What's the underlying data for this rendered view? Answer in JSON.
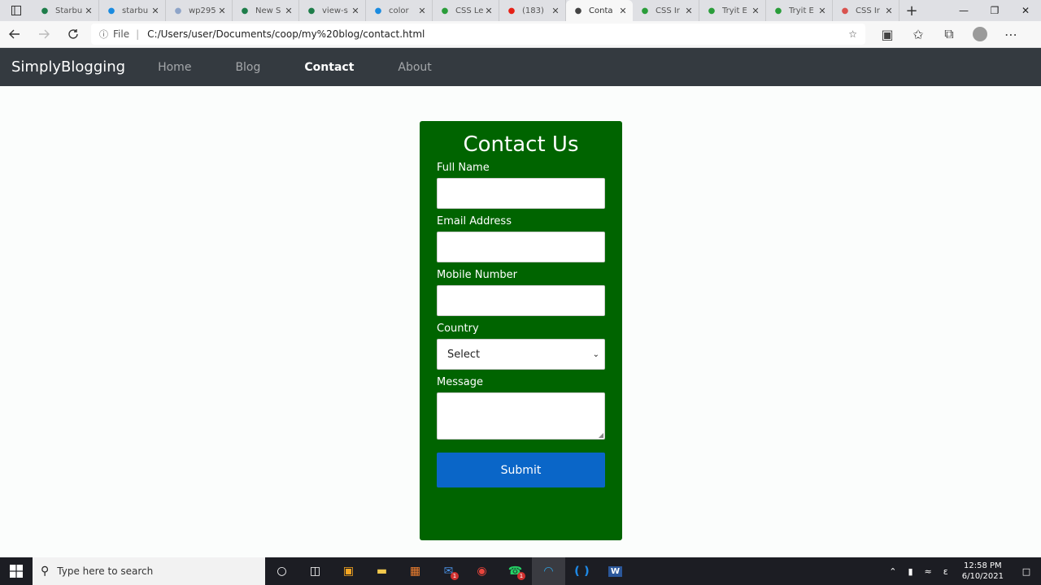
{
  "browser": {
    "tabs": [
      {
        "title": "Starbu",
        "favicon": "starbucks-icon",
        "color": "#1e7d4a"
      },
      {
        "title": "starbu",
        "favicon": "bing-icon",
        "color": "#1a8be0"
      },
      {
        "title": "wp295",
        "favicon": "wordpress-icon",
        "color": "#8ea4c8"
      },
      {
        "title": "New S",
        "favicon": "starbucks-icon",
        "color": "#1e7d4a"
      },
      {
        "title": "view-s",
        "favicon": "starbucks-icon",
        "color": "#1e7d4a"
      },
      {
        "title": "color",
        "favicon": "bing-icon",
        "color": "#1a8be0"
      },
      {
        "title": "CSS Le",
        "favicon": "w3schools-icon",
        "color": "#2a9d3a"
      },
      {
        "title": "(183)",
        "favicon": "youtube-icon",
        "color": "#e62117"
      },
      {
        "title": "Conta",
        "favicon": "page-icon",
        "color": "#444444",
        "active": true
      },
      {
        "title": "CSS Ir",
        "favicon": "w3schools-icon",
        "color": "#2a9d3a"
      },
      {
        "title": "Tryit E",
        "favicon": "w3schools-icon",
        "color": "#2a9d3a"
      },
      {
        "title": "Tryit E",
        "favicon": "w3schools-icon",
        "color": "#2a9d3a"
      },
      {
        "title": "CSS Ir",
        "favicon": "generic-site-icon",
        "color": "#d9534f"
      }
    ],
    "url_label": "File",
    "url": "C:/Users/user/Documents/coop/my%20blog/contact.html"
  },
  "site": {
    "brand": "SimplyBlogging",
    "nav": [
      {
        "label": "Home",
        "active": false
      },
      {
        "label": "Blog",
        "active": false
      },
      {
        "label": "Contact",
        "active": true
      },
      {
        "label": "About",
        "active": false
      }
    ]
  },
  "form": {
    "title": "Contact Us",
    "full_name_label": "Full Name",
    "email_label": "Email Address",
    "mobile_label": "Mobile Number",
    "country_label": "Country",
    "country_selected": "Select",
    "message_label": "Message",
    "submit_label": "Submit"
  },
  "taskbar": {
    "search_placeholder": "Type here to search",
    "time": "12:58 PM",
    "date": "6/10/2021",
    "input_language": "ε"
  },
  "colors": {
    "nav_bg": "#343a40",
    "card_bg": "#006400",
    "submit_bg": "#0a66c8"
  }
}
